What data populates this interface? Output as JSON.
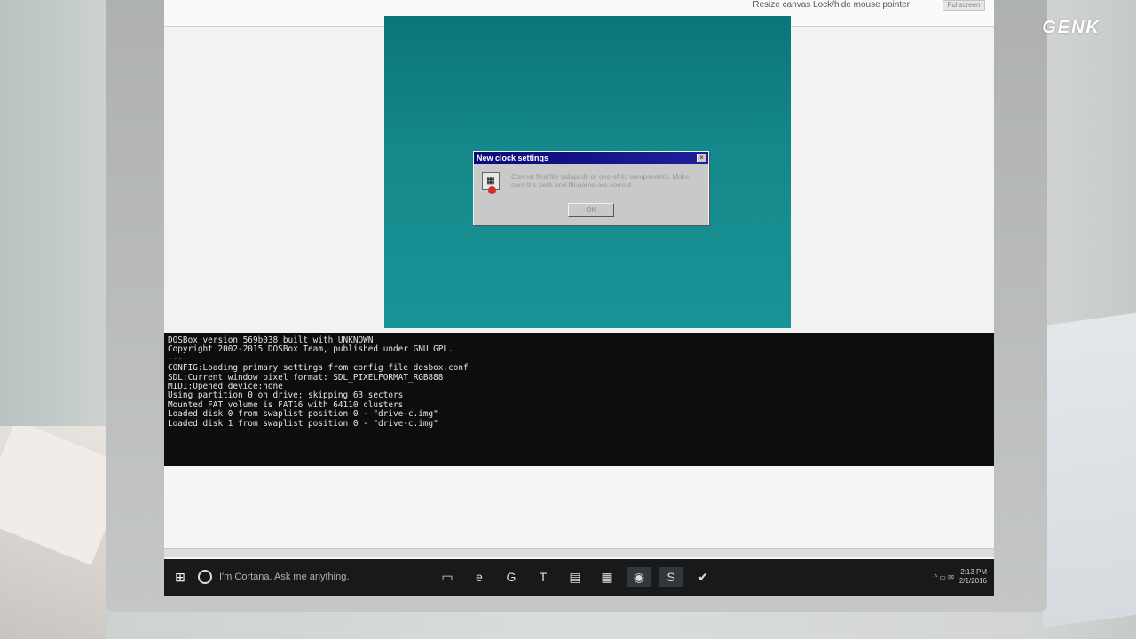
{
  "logo": "GENK",
  "topbar": {
    "options_text": "Resize canvas  Lock/hide mouse pointer",
    "fullscreen_button": "Fullscreen"
  },
  "dialog": {
    "title": "New clock settings",
    "close_glyph": "×",
    "message": "Cannot find file vtdapi.dll or one of its components. Make sure the path and filename are correct.",
    "ok_label": "OK"
  },
  "console": {
    "lines": [
      "DOSBox version 569b038 built with UNKNOWN",
      "Copyright 2002-2015 DOSBox Team, published under GNU GPL.",
      "---",
      "CONFIG:Loading primary settings from config file dosbox.conf",
      "SDL:Current window pixel format: SDL_PIXELFORMAT_RGB888",
      "MIDI:Opened device:none",
      "Using partition 0 on drive; skipping 63 sectors",
      "Mounted FAT volume is FAT16 with 64110 clusters",
      "Loaded disk 0 from swaplist position 0 - \"drive-c.img\"",
      "Loaded disk 1 from swaplist position 0 - \"drive-c.img\""
    ]
  },
  "taskbar": {
    "cortana_placeholder": "I'm Cortana. Ask me anything.",
    "pinned": [
      {
        "name": "task-view",
        "glyph": "▭"
      },
      {
        "name": "edge",
        "glyph": "e"
      },
      {
        "name": "gotv",
        "glyph": "G"
      },
      {
        "name": "t-app",
        "glyph": "T"
      },
      {
        "name": "file-explorer",
        "glyph": "▤"
      },
      {
        "name": "store",
        "glyph": "▦"
      },
      {
        "name": "chrome",
        "glyph": "◉"
      },
      {
        "name": "skype",
        "glyph": "S"
      },
      {
        "name": "visual-studio",
        "glyph": "✔"
      }
    ],
    "tray_glyphs": "^ ▭ ✉",
    "time": "2:13 PM",
    "date": "2/1/2016"
  },
  "colors": {
    "canvas_teal": "#14898b",
    "title_blue": "#0a0a7a",
    "taskbar_bg": "#17191b"
  }
}
